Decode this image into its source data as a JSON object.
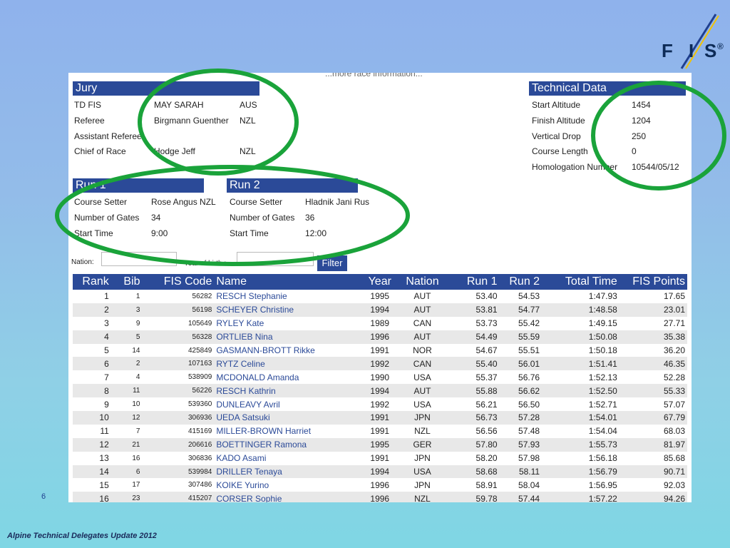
{
  "logo": {
    "letters": [
      "F",
      "I",
      "S"
    ],
    "mark": "®"
  },
  "more_info": "...more race information...",
  "jury": {
    "header": "Jury",
    "rows": [
      {
        "role": "TD FIS",
        "name": "MAY SARAH",
        "nation": "AUS"
      },
      {
        "role": "Referee",
        "name": "Birgmann Guenther",
        "nation": "NZL"
      },
      {
        "role": "Assistant Referee",
        "name": "",
        "nation": ""
      },
      {
        "role": "Chief of Race",
        "name": "Hodge Jeff",
        "nation": "NZL"
      }
    ]
  },
  "technical": {
    "header": "Technical Data",
    "rows": [
      {
        "label": "Start Altitude",
        "value": "1454"
      },
      {
        "label": "Finish Altitude",
        "value": "1204"
      },
      {
        "label": "Vertical Drop",
        "value": "250"
      },
      {
        "label": "Course Length",
        "value": "0"
      },
      {
        "label": "Homologation Number",
        "value": "10544/05/12"
      }
    ]
  },
  "run1": {
    "header": "Run 1",
    "course_setter_label": "Course Setter",
    "course_setter": "Rose Angus NZL",
    "gates_label": "Number of Gates",
    "gates": "34",
    "start_label": "Start Time",
    "start": "9:00"
  },
  "run2": {
    "header": "Run 2",
    "course_setter_label": "Course Setter",
    "course_setter": "Hladnik Jani Rus",
    "gates_label": "Number of Gates",
    "gates": "36",
    "start_label": "Start Time",
    "start": "12:00"
  },
  "filter": {
    "nation_label": "Nation:",
    "year_label": "Year of birth :",
    "button": "Filter"
  },
  "columns": [
    "Rank",
    "Bib",
    "FIS Code",
    "Name",
    "Year",
    "Nation",
    "Run 1",
    "Run 2",
    "Total Time",
    "FIS Points"
  ],
  "results": [
    [
      "1",
      "1",
      "56282",
      "RESCH Stephanie",
      "1995",
      "AUT",
      "53.40",
      "54.53",
      "1:47.93",
      "17.65"
    ],
    [
      "2",
      "3",
      "56198",
      "SCHEYER Christine",
      "1994",
      "AUT",
      "53.81",
      "54.77",
      "1:48.58",
      "23.01"
    ],
    [
      "3",
      "9",
      "105649",
      "RYLEY Kate",
      "1989",
      "CAN",
      "53.73",
      "55.42",
      "1:49.15",
      "27.71"
    ],
    [
      "4",
      "5",
      "56328",
      "ORTLIEB Nina",
      "1996",
      "AUT",
      "54.49",
      "55.59",
      "1:50.08",
      "35.38"
    ],
    [
      "5",
      "14",
      "425849",
      "GASMANN-BROTT Rikke",
      "1991",
      "NOR",
      "54.67",
      "55.51",
      "1:50.18",
      "36.20"
    ],
    [
      "6",
      "2",
      "107163",
      "RYTZ Celine",
      "1992",
      "CAN",
      "55.40",
      "56.01",
      "1:51.41",
      "46.35"
    ],
    [
      "7",
      "4",
      "538909",
      "MCDONALD Amanda",
      "1990",
      "USA",
      "55.37",
      "56.76",
      "1:52.13",
      "52.28"
    ],
    [
      "8",
      "11",
      "56226",
      "RESCH Kathrin",
      "1994",
      "AUT",
      "55.88",
      "56.62",
      "1:52.50",
      "55.33"
    ],
    [
      "9",
      "10",
      "539360",
      "DUNLEAVY Avril",
      "1992",
      "USA",
      "56.21",
      "56.50",
      "1:52.71",
      "57.07"
    ],
    [
      "10",
      "12",
      "306936",
      "UEDA Satsuki",
      "1991",
      "JPN",
      "56.73",
      "57.28",
      "1:54.01",
      "67.79"
    ],
    [
      "11",
      "7",
      "415169",
      "MILLER-BROWN Harriet",
      "1991",
      "NZL",
      "56.56",
      "57.48",
      "1:54.04",
      "68.03"
    ],
    [
      "12",
      "21",
      "206616",
      "BOETTINGER Ramona",
      "1995",
      "GER",
      "57.80",
      "57.93",
      "1:55.73",
      "81.97"
    ],
    [
      "13",
      "16",
      "306836",
      "KADO Asami",
      "1991",
      "JPN",
      "58.20",
      "57.98",
      "1:56.18",
      "85.68"
    ],
    [
      "14",
      "6",
      "539984",
      "DRILLER Tenaya",
      "1994",
      "USA",
      "58.68",
      "58.11",
      "1:56.79",
      "90.71"
    ],
    [
      "15",
      "17",
      "307486",
      "KOIKE Yurino",
      "1996",
      "JPN",
      "58.91",
      "58.04",
      "1:56.95",
      "92.03"
    ],
    [
      "16",
      "23",
      "415207",
      "CORSER Sophie",
      "1996",
      "NZL",
      "59.78",
      "57.44",
      "1:57.22",
      "94.26"
    ]
  ],
  "page_number": "6",
  "footer": "Alpine Technical Delegates Update 2012",
  "colors": {
    "header": "#2b4a98",
    "highlight_circle": "#1aa33a"
  }
}
